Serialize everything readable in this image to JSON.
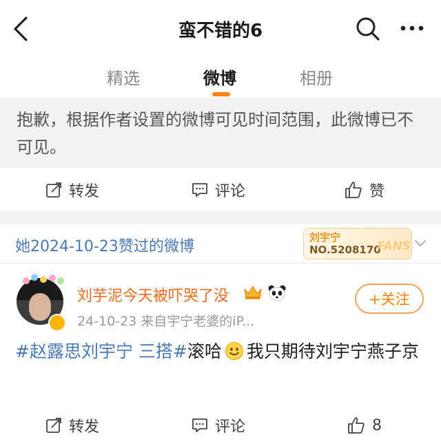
{
  "header": {
    "title": "蛮不错的6",
    "icons": [
      "back-icon",
      "search-icon",
      "more-icon"
    ]
  },
  "tabs": [
    {
      "label": "精选",
      "active": false
    },
    {
      "label": "微博",
      "active": true
    },
    {
      "label": "相册",
      "active": false
    }
  ],
  "unavailable_post": {
    "message": "抱歉，根据作者设置的微博可见时间范围，此微博已不可见。",
    "actions": {
      "repost": "转发",
      "comment": "评论",
      "like": "赞"
    }
  },
  "liked_section": {
    "label": "她2024-10-23赞过的微博",
    "fans_badge": {
      "name": "刘宇宁",
      "number": "NO.5208170",
      "word": "FANS"
    }
  },
  "post": {
    "username": "刘芋泥今天被吓哭了没",
    "timestamp": "24-10-23",
    "source": "来自宇宁老婆的iP...",
    "follow_label": "+关注",
    "hashtag": "#赵露思刘宇宁 三搭#",
    "text_before_emoji": "滚哈",
    "text_after_emoji": "我只期待刘宇宁燕子京",
    "actions": {
      "repost": "转发",
      "comment": "评论",
      "like_count": "8"
    }
  },
  "colors": {
    "accent": "#ff8200",
    "link": "#4a79b6",
    "username": "#f26b1d",
    "separator": "#f2f2f2"
  }
}
